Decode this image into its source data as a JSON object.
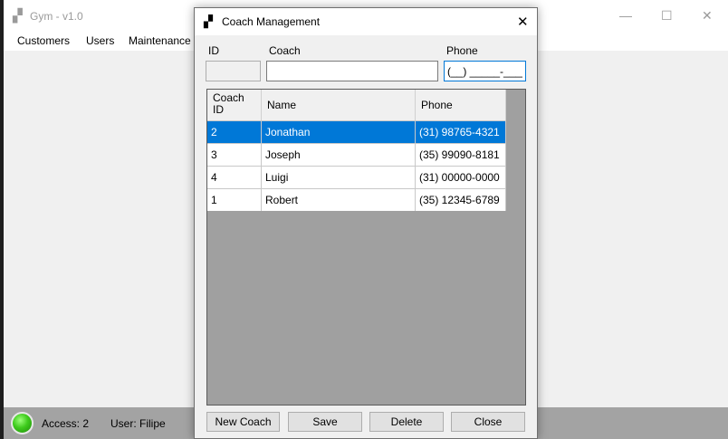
{
  "main_window": {
    "title": "Gym - v1.0",
    "menu": [
      "Customers",
      "Users",
      "Maintenance"
    ],
    "controls": {
      "minimize": "—",
      "maximize": "☐",
      "close": "✕"
    },
    "status": {
      "access": "Access: 2",
      "user": "User: Filipe"
    }
  },
  "dialog": {
    "title": "Coach Management",
    "close_glyph": "✕",
    "labels": {
      "id": "ID",
      "coach": "Coach",
      "phone": "Phone"
    },
    "fields": {
      "id": "",
      "coach": "",
      "phone": "(__) _____-____"
    },
    "grid": {
      "columns": [
        "Coach ID",
        "Name",
        "Phone"
      ],
      "rows": [
        {
          "id": "2",
          "name": "Jonathan",
          "phone": "(31) 98765-4321",
          "selected": true
        },
        {
          "id": "3",
          "name": "Joseph",
          "phone": "(35) 99090-8181",
          "selected": false
        },
        {
          "id": "4",
          "name": "Luigi",
          "phone": "(31) 00000-0000",
          "selected": false
        },
        {
          "id": "1",
          "name": "Robert",
          "phone": "(35) 12345-6789",
          "selected": false
        }
      ]
    },
    "buttons": {
      "new": "New Coach",
      "save": "Save",
      "delete": "Delete",
      "close": "Close"
    }
  },
  "colors": {
    "selection": "#0078d7",
    "grid_background": "#a0a0a0",
    "status_bar": "#a3a3a3",
    "led": "#3ecb1c"
  }
}
